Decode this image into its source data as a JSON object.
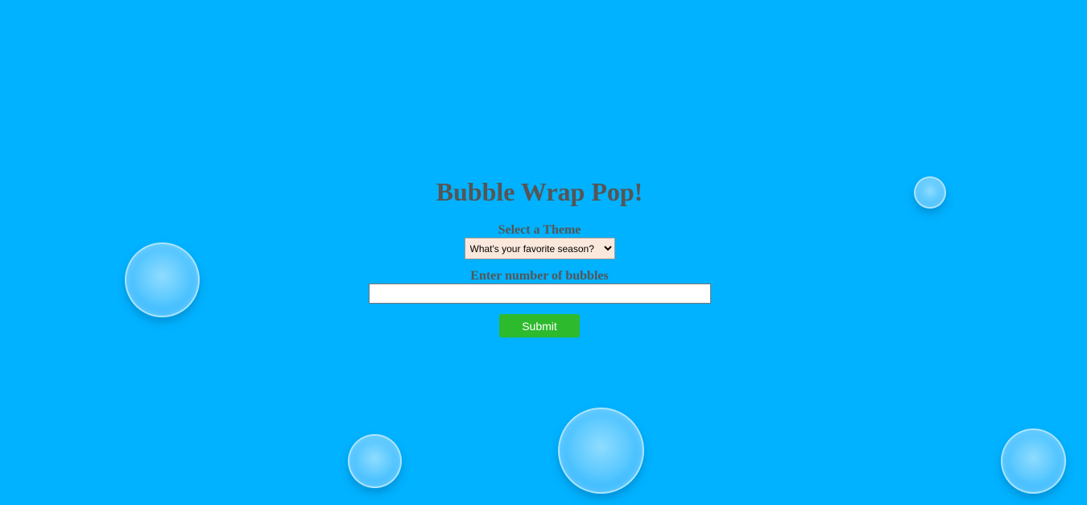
{
  "page": {
    "title": "Bubble Wrap Pop!",
    "background_color": "#00b2ff",
    "bubble_color": "#5cc9ff"
  },
  "form": {
    "theme_label": "Select a Theme",
    "theme_selected": "What's your favorite season?",
    "count_label": "Enter number of bubbles",
    "count_value": "",
    "submit_label": "Submit",
    "submit_color": "#2dba2d"
  }
}
